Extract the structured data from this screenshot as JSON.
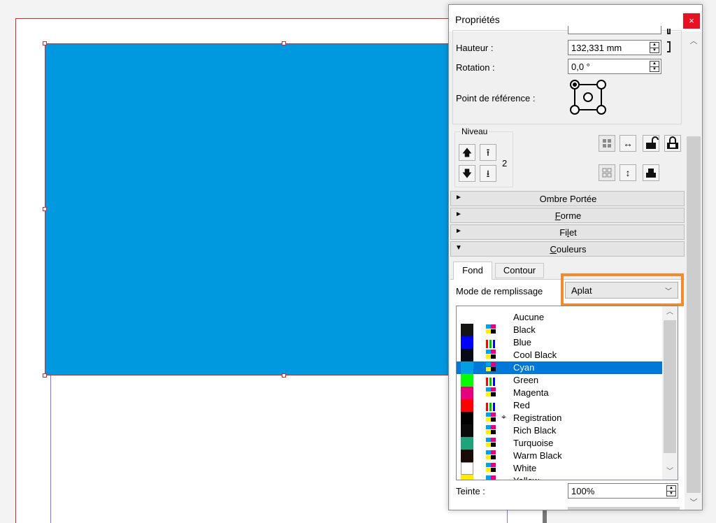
{
  "panel": {
    "title": "Propriétés",
    "close_glyph": "×",
    "scroll_up_glyph": "︿",
    "scroll_down_glyph": "﹀"
  },
  "geometry": {
    "hauteur_label": "Hauteur :",
    "hauteur_value": "132,331 mm",
    "rotation_label": "Rotation :",
    "rotation_value": "0,0 °",
    "reference_point_label": "Point de référence :"
  },
  "level": {
    "group_label": "Niveau",
    "count": "2",
    "raise_glyph": "🡅",
    "raise_top_glyph": "⭱",
    "lower_glyph": "🡇",
    "lower_bottom_glyph": "⭳"
  },
  "sections": [
    {
      "title": "Ombre Portée",
      "expanded": false,
      "glyph": "►"
    },
    {
      "title": "Forme",
      "expanded": false,
      "glyph": "►"
    },
    {
      "title": "Filet",
      "expanded": false,
      "glyph": "►"
    },
    {
      "title": "Couleurs",
      "expanded": true,
      "glyph": "▼"
    }
  ],
  "colors": {
    "tabs": [
      "Fond",
      "Contour"
    ],
    "active_tab": "Fond",
    "fill_mode_label": "Mode de remplissage",
    "fill_mode_value": "Aplat",
    "fill_mode_chevron": "﹀",
    "list_up_glyph": "︿",
    "list_down_glyph": "﹀",
    "swatches": [
      {
        "name": "Aucune",
        "color": "none",
        "kind": "none"
      },
      {
        "name": "Black",
        "color": "#141414",
        "kind": "cmyk"
      },
      {
        "name": "Blue",
        "color": "#0000ff",
        "kind": "rgb"
      },
      {
        "name": "Cool Black",
        "color": "#050a14",
        "kind": "cmyk"
      },
      {
        "name": "Cyan",
        "color": "#009fe3",
        "kind": "cmyk",
        "selected": true
      },
      {
        "name": "Green",
        "color": "#00ff00",
        "kind": "rgb"
      },
      {
        "name": "Magenta",
        "color": "#e6007e",
        "kind": "cmyk"
      },
      {
        "name": "Red",
        "color": "#ff0000",
        "kind": "rgb"
      },
      {
        "name": "Registration",
        "color": "#000000",
        "kind": "registration"
      },
      {
        "name": "Rich Black",
        "color": "#0a0a0a",
        "kind": "cmyk"
      },
      {
        "name": "Turquoise",
        "color": "#1fa37a",
        "kind": "cmyk"
      },
      {
        "name": "Warm Black",
        "color": "#1a0a08",
        "kind": "cmyk"
      },
      {
        "name": "White",
        "color": "#ffffff",
        "kind": "cmyk"
      },
      {
        "name": "Yellow",
        "color": "#ffed00",
        "kind": "cmyk"
      }
    ],
    "registration_glyph": "⌖",
    "tint_label": "Teinte :",
    "tint_value": "100%"
  },
  "accent": {
    "shape_fill": "#0099e0",
    "selection": "#0078d7",
    "highlight": "#f28a2e",
    "close_bg": "#e81123"
  }
}
